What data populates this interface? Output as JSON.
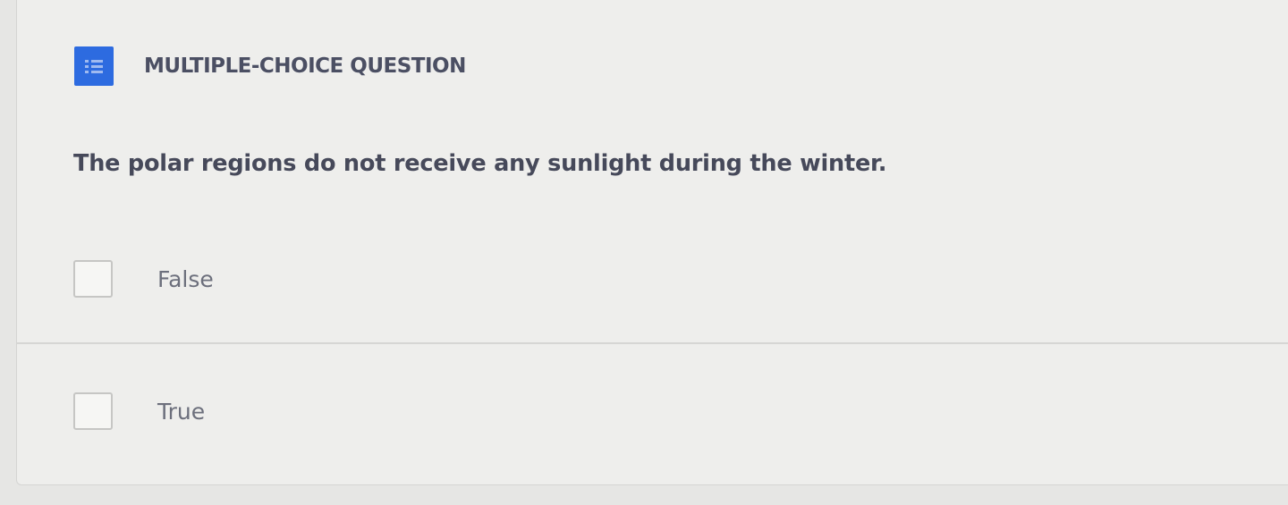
{
  "question": {
    "type_label": "MULTIPLE-CHOICE QUESTION",
    "type_icon": "list-icon",
    "text": "The polar regions do not receive any sunlight during the winter."
  },
  "options": [
    {
      "label": "False",
      "checked": false
    },
    {
      "label": "True",
      "checked": false
    }
  ],
  "colors": {
    "accent": "#2d6be0",
    "text_dark": "#46495a",
    "text_muted": "#6c6f7c",
    "background": "#eeeeec"
  }
}
